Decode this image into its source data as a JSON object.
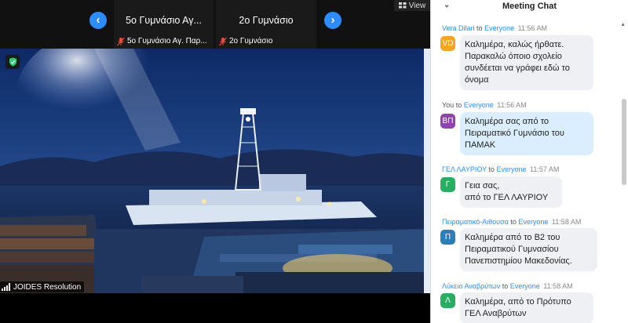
{
  "thumbnails": [
    {
      "big_name": "5o Γυμνάσιο Αγ...",
      "footer_name": "5ο Γυμνάσιο Αγ. Παρ..."
    },
    {
      "big_name": "2ο Γυμνάσιο",
      "footer_name": "2ο Γυμνάσιο"
    }
  ],
  "view_label": "View",
  "main_video": {
    "participant_name": "JOIDES Resolution"
  },
  "chat": {
    "title": "Meeting Chat",
    "to_label": "to",
    "messages": [
      {
        "sender": "Vera Dilari",
        "recipient": "Everyone",
        "time": "11:56 AM",
        "initials": "VD",
        "avatar_color": "#f5a524",
        "lines": [
          "Καλημέρα, καλώς ήρθατε.",
          "Παρακαλώ όποιο σχολείο",
          "συνδέεται να γράφει εδώ το",
          "όνομα"
        ]
      },
      {
        "sender": "You",
        "recipient": "Everyone",
        "time": "11:56 AM",
        "initials": "ΒΠ",
        "avatar_color": "#8e44ad",
        "lines": [
          "Καλημέρα σας από το",
          "Πειραματικό Γυμνάσιο του",
          "ΠΑΜΑΚ"
        ]
      },
      {
        "sender": "ΓΕΛ ΛΑΥΡΙΟΥ",
        "recipient": "Everyone",
        "time": "11:57 AM",
        "initials": "Γ",
        "avatar_color": "#27ae60",
        "lines": [
          "Γεια σας,",
          " από το ΓΕΛ ΛΑΥΡΙΟΥ"
        ]
      },
      {
        "sender": "Πειραματικό-Αιθουσα",
        "recipient": "Everyone",
        "time": "11:58 AM",
        "initials": "Π",
        "avatar_color": "#2980b9",
        "lines": [
          "Καλημέρα από το Β2 του",
          "Πειραματικού Γυμνασίου",
          "Πανεπιστημίου Μακεδονίας."
        ]
      },
      {
        "sender": "Λύκειο Αναβρύτων",
        "recipient": "Everyone",
        "time": "11:58 AM",
        "initials": "Λ",
        "avatar_color": "#27ae60",
        "lines": [
          "Καλημέρα, από το Πρότυπο",
          "ΓΕΛ Αναβρύτων"
        ]
      }
    ]
  }
}
